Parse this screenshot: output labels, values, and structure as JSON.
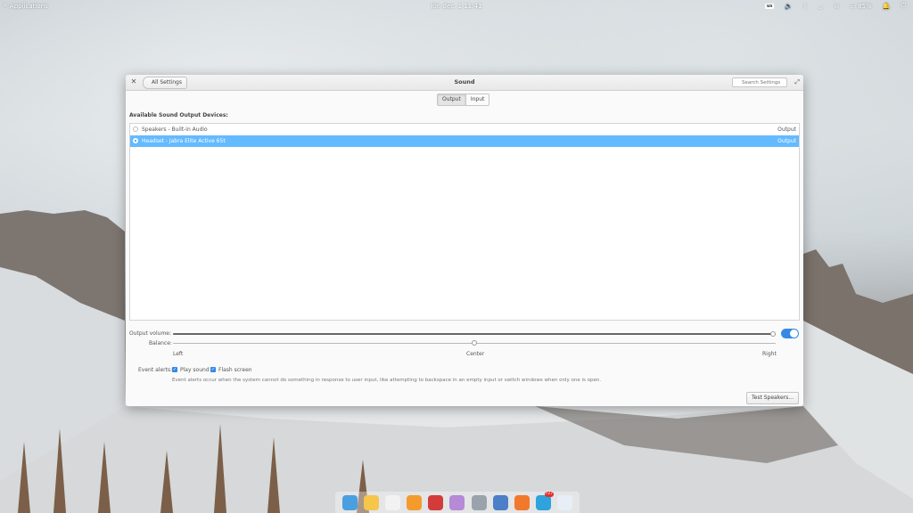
{
  "panel": {
    "applications_label": "Applications",
    "clock": "lör. dec. 1   11:41",
    "keyboard_layout": "us",
    "battery_label": "85%"
  },
  "window": {
    "title": "Sound",
    "back_label": "All Settings",
    "search_placeholder": "Search Settings"
  },
  "tabs": [
    {
      "label": "Output",
      "active": true
    },
    {
      "label": "Input",
      "active": false
    }
  ],
  "devices_heading": "Available Sound Output Devices:",
  "devices": [
    {
      "name": "Speakers - Built-in Audio",
      "type": "Output",
      "selected": false
    },
    {
      "name": "Headset - Jabra Elite Active 65t",
      "type": "Output",
      "selected": true
    }
  ],
  "volume": {
    "label": "Output volume:",
    "level": 1.0,
    "enabled": true
  },
  "balance": {
    "label": "Balance:",
    "left": "Left",
    "center": "Center",
    "right": "Right",
    "value": 0.5
  },
  "event_alerts": {
    "label": "Event alerts:",
    "play_sound": {
      "label": "Play sound",
      "checked": true
    },
    "flash_screen": {
      "label": "Flash screen",
      "checked": true
    },
    "note": "Event alerts occur when the system cannot do something in response to user input, like attempting to backspace in an empty input or switch windows when only one is open."
  },
  "test_button": "Test Speakers...",
  "dock": {
    "items": [
      {
        "icon": "browser-icon",
        "color": "#4a9fe0"
      },
      {
        "icon": "mail-icon",
        "color": "#f5c64a"
      },
      {
        "icon": "calendar-icon",
        "color": "#f2f2f2"
      },
      {
        "icon": "music-icon",
        "color": "#f39c2d"
      },
      {
        "icon": "videos-icon",
        "color": "#d33b3b"
      },
      {
        "icon": "photos-icon",
        "color": "#b58ad6"
      },
      {
        "icon": "app-center-icon",
        "color": "#9aa3ab"
      },
      {
        "icon": "switchboard-icon",
        "color": "#4d7fc6"
      },
      {
        "icon": "firefox-icon",
        "color": "#f2792b"
      },
      {
        "icon": "telegram-icon",
        "color": "#2ea3dc",
        "badge": "727"
      },
      {
        "icon": "toggle-settings-icon",
        "color": "#e8eef5"
      }
    ]
  }
}
